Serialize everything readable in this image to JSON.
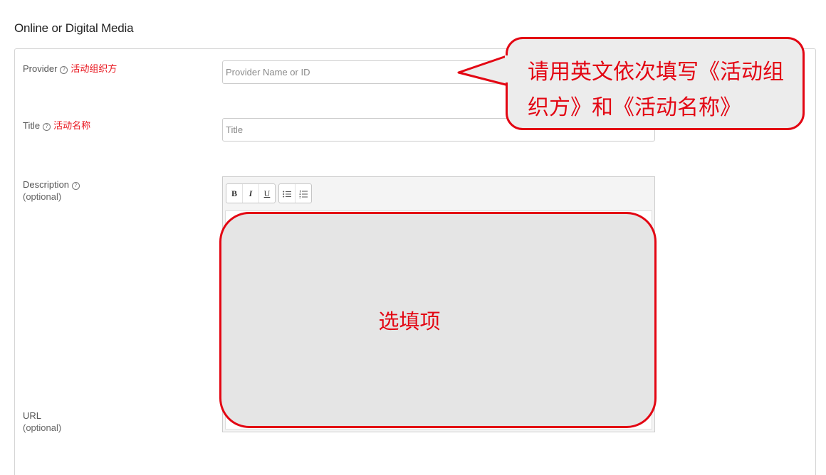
{
  "section": {
    "title": "Online or Digital Media"
  },
  "fields": {
    "provider": {
      "label": "Provider",
      "help_icon": "?",
      "cn_label": "活动组织方",
      "placeholder": "Provider Name or ID",
      "value": ""
    },
    "title": {
      "label": "Title",
      "help_icon": "?",
      "cn_label": "活动名称",
      "placeholder": "Title",
      "value": ""
    },
    "description": {
      "label": "Description",
      "help_icon": "?",
      "optional": "(optional)",
      "toolbar": {
        "bold": "B",
        "italic": "I",
        "underline": "U",
        "bullet_list_icon": "bullet-list-icon",
        "numbered_list_icon": "numbered-list-icon"
      }
    },
    "url": {
      "label": "URL",
      "optional": "(optional)"
    }
  },
  "annotations": {
    "callout_text": "请用英文依次填写《活动组织方》和《活动名称》",
    "optional_overlay_text": "选填项",
    "accent_color": "#e30613"
  }
}
